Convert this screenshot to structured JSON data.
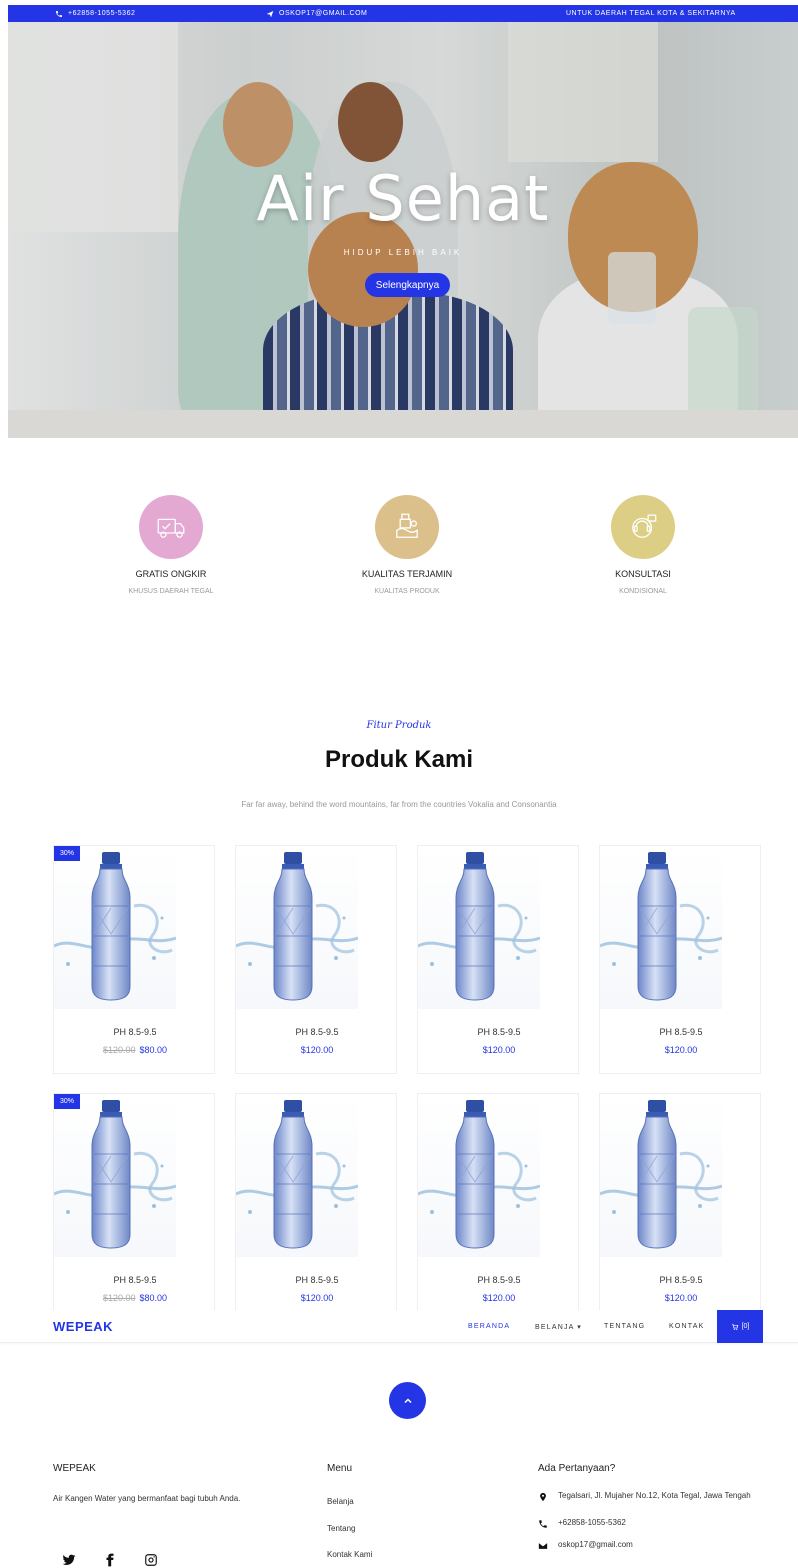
{
  "topbar": {
    "phone": "+62858-1055-5362",
    "email": "OSKOP17@GMAIL.COM",
    "area": "UNTUK DAERAH TEGAL KOTA & SEKITARNYA"
  },
  "hero": {
    "title": "Air Sehat",
    "subtitle": "HIDUP LEBIH BAIK",
    "button": "Selengkapnya"
  },
  "services": [
    {
      "title": "GRATIS ONGKIR",
      "subtitle": "KHUSUS DAERAH TEGAL",
      "color": "#e3a9d3",
      "icon": "delivery-truck-icon"
    },
    {
      "title": "KUALITAS TERJAMIN",
      "subtitle": "KUALITAS PRODUK",
      "color": "#dcc08b",
      "icon": "quality-icon"
    },
    {
      "title": "KONSULTASI",
      "subtitle": "KONDISIONAL",
      "color": "#dccf85",
      "icon": "consultation-icon"
    }
  ],
  "products_section": {
    "subheading": "Fitur Produk",
    "heading": "Produk Kami",
    "description": "Far far away, behind the word mountains, far from the countries Vokalia and Consonantia"
  },
  "products": [
    {
      "name": "PH 8.5-9.5",
      "badge": "30%",
      "old_price": "$120.00",
      "price": "$80.00"
    },
    {
      "name": "PH 8.5-9.5",
      "badge": "",
      "old_price": "",
      "price": "$120.00"
    },
    {
      "name": "PH 8.5-9.5",
      "badge": "",
      "old_price": "",
      "price": "$120.00"
    },
    {
      "name": "PH 8.5-9.5",
      "badge": "",
      "old_price": "",
      "price": "$120.00"
    },
    {
      "name": "PH 8.5-9.5",
      "badge": "30%",
      "old_price": "$120.00",
      "price": "$80.00"
    },
    {
      "name": "PH 8.5-9.5",
      "badge": "",
      "old_price": "",
      "price": "$120.00"
    },
    {
      "name": "PH 8.5-9.5",
      "badge": "",
      "old_price": "",
      "price": "$120.00"
    },
    {
      "name": "PH 8.5-9.5",
      "badge": "",
      "old_price": "",
      "price": "$120.00"
    }
  ],
  "navbar": {
    "brand": "WEPEAK",
    "items": [
      "BERANDA",
      "BELANJA",
      "TENTANG",
      "KONTAK"
    ],
    "active": "BERANDA",
    "cart": "[0]"
  },
  "footer": {
    "about_title": "WEPEAK",
    "about_text": "Air Kangen Water yang bermanfaat bagi tubuh Anda.",
    "menu_title": "Menu",
    "menu_items": [
      "Belanja",
      "Tentang",
      "Kontak Kami"
    ],
    "contact_title": "Ada Pertanyaan?",
    "address": "Tegalsari, Jl. Mujaher No.12, Kota Tegal, Jawa Tengah",
    "phone": "+62858-1055-5362",
    "email": "oskop17@gmail.com"
  },
  "colors": {
    "accent": "#2435e6"
  }
}
